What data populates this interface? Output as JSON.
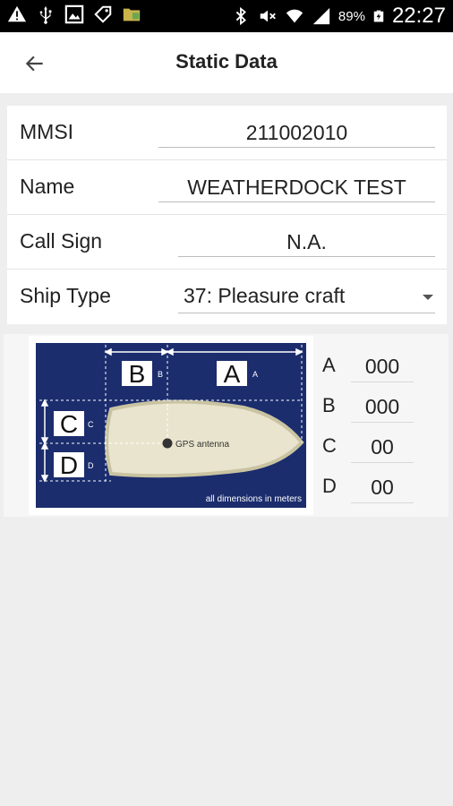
{
  "status_bar": {
    "battery": "89%",
    "time": "22:27",
    "icons_left": [
      "warning-icon",
      "usb-icon",
      "image-icon",
      "tag-icon",
      "folder-icon"
    ],
    "icons_right": [
      "bluetooth-icon",
      "mute-icon",
      "wifi-icon",
      "signal-icon",
      "battery-icon"
    ]
  },
  "app_bar": {
    "title": "Static Data",
    "back_icon": "arrow-left-icon"
  },
  "form": {
    "mmsi": {
      "label": "MMSI",
      "value": "211002010"
    },
    "name": {
      "label": "Name",
      "value": "WEATHERDOCK TEST"
    },
    "call_sign": {
      "label": "Call Sign",
      "value": "N.A."
    },
    "ship_type": {
      "label": "Ship Type",
      "value": "37: Pleasure craft"
    }
  },
  "diagram": {
    "labels": {
      "a": "A",
      "b": "B",
      "c": "C",
      "d": "D"
    },
    "small_labels": {
      "a": "A",
      "b": "B",
      "c": "C",
      "d": "D"
    },
    "gps_text": "GPS antenna",
    "footer_text": "all dimensions in meters",
    "colors": {
      "background": "#1b2d6d",
      "hull": "#e8e4cd",
      "hull_edge": "#c9c3a2"
    }
  },
  "dimensions": [
    {
      "label": "A",
      "value": "000"
    },
    {
      "label": "B",
      "value": "000"
    },
    {
      "label": "C",
      "value": "00"
    },
    {
      "label": "D",
      "value": "00"
    }
  ]
}
